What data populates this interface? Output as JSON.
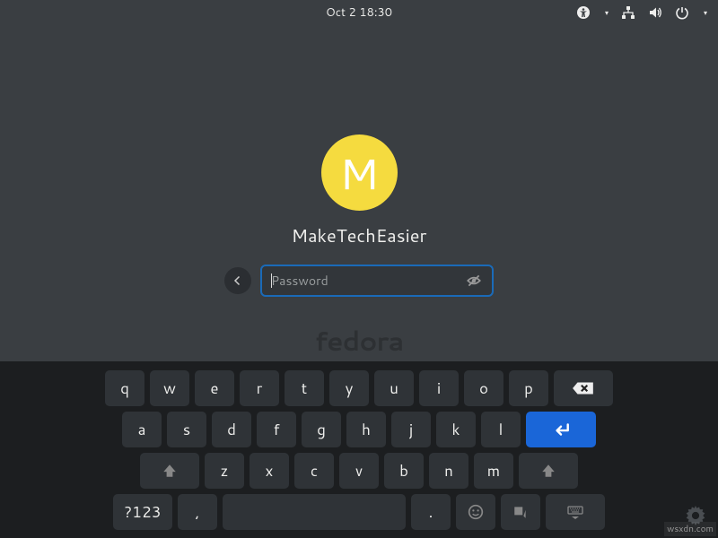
{
  "topbar": {
    "clock": "Oct 2  18:30"
  },
  "login": {
    "avatar_letter": "M",
    "username": "MakeTechEasier",
    "password_placeholder": "Password"
  },
  "watermark": "fedora",
  "keyboard": {
    "row1": [
      "q",
      "w",
      "e",
      "r",
      "t",
      "y",
      "u",
      "i",
      "o",
      "p"
    ],
    "row2": [
      "a",
      "s",
      "d",
      "f",
      "g",
      "h",
      "j",
      "k",
      "l"
    ],
    "row3": [
      "z",
      "x",
      "c",
      "v",
      "b",
      "n",
      "m"
    ],
    "symbols_key": "?123",
    "comma_key": ",",
    "period_key": "."
  },
  "site_watermark": "wsxdn.com"
}
